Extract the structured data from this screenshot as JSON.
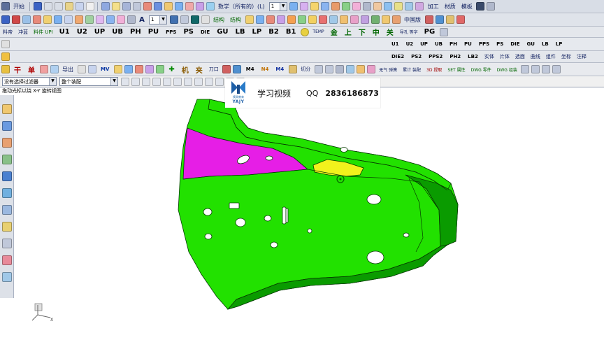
{
  "window": {
    "start_menu_label": "开始",
    "start_menu_icon": "gear-start-icon"
  },
  "toolbar_row1": {
    "labels": {
      "processing": "加工",
      "material": "材质",
      "template": "模板"
    },
    "icons": [
      "save-icon",
      "undo-icon",
      "redo-icon",
      "cut-icon",
      "copy-icon",
      "paste-icon",
      "sketch-icon",
      "curve-icon",
      "line-icon",
      "arc-icon",
      "spline-icon",
      "point-icon",
      "extrude-icon",
      "revolve-icon",
      "hole-icon",
      "trim-icon",
      "sew-icon",
      "offset-icon",
      "measure-icon",
      "layer-icon",
      "view-icon",
      "shade-icon",
      "render-icon",
      "analysis-icon",
      "ruler-icon"
    ],
    "combo_value": "1",
    "note_text": "数学（所有的）(L)"
  },
  "toolbar_row2": {
    "combo_value": "1",
    "labels": {
      "china_fit": "中国版",
      "arrow_label": "A"
    },
    "small_labels": [
      "结构",
      "结构"
    ]
  },
  "toolbar_row3": {
    "left_labels": [
      "料帝",
      "冲蓝",
      "料件 UPI"
    ],
    "codes": [
      "U1",
      "U2",
      "UP",
      "UB",
      "PH",
      "PU",
      "PPS",
      "PS",
      "DIE",
      "GU",
      "LB",
      "LP",
      "B2",
      "B1"
    ],
    "temp_label": "TEMP",
    "cn_labels": [
      "金",
      "上",
      "下",
      "中",
      "关"
    ],
    "mid_label": "导孔 等字",
    "pg_label": "PG"
  },
  "toolbar_row4": {
    "codes": [
      "U1",
      "U2",
      "UP",
      "UB",
      "PH",
      "PU",
      "PPS",
      "PS",
      "DIE",
      "GU",
      "LB",
      "LP"
    ]
  },
  "toolbar_row5": {
    "codes": [
      "DIE2",
      "PS2",
      "PPS2",
      "PH2",
      "LB2"
    ],
    "cn_labels": [
      "实体",
      "片体",
      "选面",
      "曲线",
      "组件",
      "坐标",
      "注释"
    ]
  },
  "toolbar_row6": {
    "labels": {
      "gan": "干",
      "dan": "单",
      "export": "导出",
      "mv": "MV",
      "ji": "机",
      "jia": "夹",
      "knife": "刀口",
      "m4": "M4",
      "n4": "N4",
      "m4b": "M4",
      "qiefen": "切分",
      "wuji": "无气 弹簧",
      "leiji": "累计 装配",
      "3d": "3D 提取",
      "set": "SET 属性",
      "dwg1": "DWG 零件",
      "dwg2": "DWG 组装"
    }
  },
  "selection_bar": {
    "filter_placeholder": "没有选择过滤器",
    "filter_value": "没有选择过滤器",
    "scope_value": "整个装配"
  },
  "status_bar": {
    "text": "拖动光标以绕 X-Y 旋转视图"
  },
  "left_rail": {
    "icons": [
      "assembly-navigator-icon",
      "constraint-navigator-icon",
      "part-navigator-icon",
      "reuse-library-icon",
      "history-icon",
      "web-browser-icon",
      "clock-icon",
      "process-studio-icon",
      "roles-icon",
      "palette-icon",
      "system-scene-icon"
    ]
  },
  "watermark": {
    "brand": "YAJY",
    "subtitle": "模具教育",
    "title": "学习视频",
    "qq_label": "QQ",
    "qq_number": "2836186873"
  },
  "model": {
    "colors": {
      "main": "#22e100",
      "main_dark": "#0a9b00",
      "edge": "#063b00",
      "highlight_magenta": "#e61ee6",
      "highlight_yellow": "#f2f21c"
    }
  },
  "colors": {
    "toolbar_bg": "#d8dde6",
    "viewport_bg": "#ffffff"
  }
}
